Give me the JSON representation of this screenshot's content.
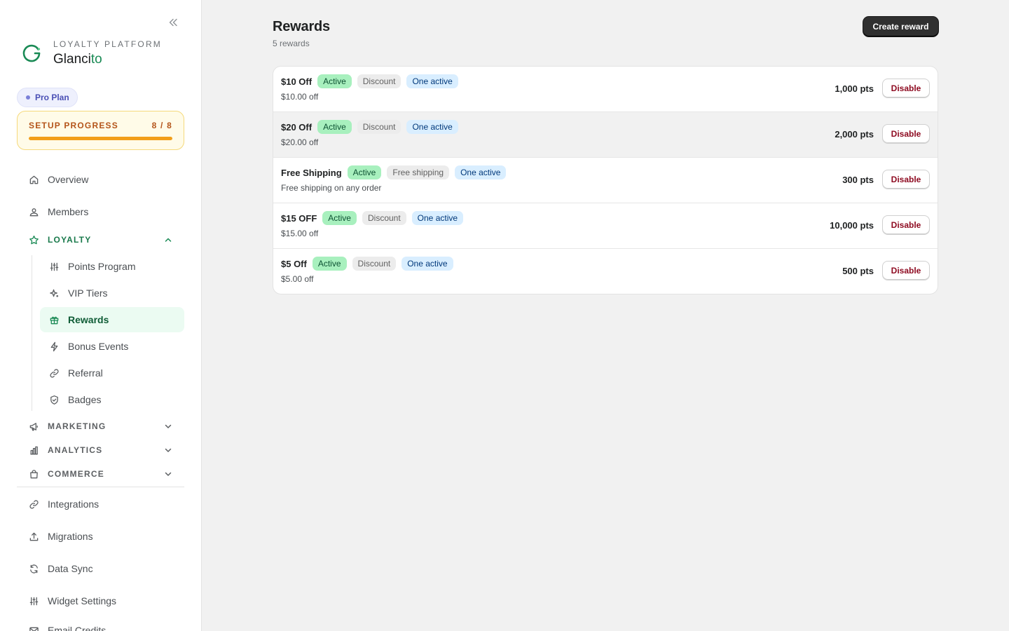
{
  "brand": {
    "eyebrow": "LOYALTY PLATFORM",
    "name_main": "Glanci",
    "name_accent": "to"
  },
  "plan": {
    "label": "Pro Plan"
  },
  "setup": {
    "label": "SETUP PROGRESS",
    "count": "8 / 8",
    "progress": 1.0
  },
  "nav": {
    "overview": "Overview",
    "members": "Members",
    "loyalty": "LOYALTY",
    "loyalty_items": {
      "points": "Points Program",
      "vip": "VIP Tiers",
      "rewards": "Rewards",
      "bonus": "Bonus Events",
      "referral": "Referral",
      "badges": "Badges"
    },
    "marketing": "MARKETING",
    "analytics": "ANALYTICS",
    "commerce": "COMMERCE",
    "integrations": "Integrations",
    "migrations": "Migrations",
    "datasync": "Data Sync",
    "widget": "Widget Settings",
    "email": "Email Credits"
  },
  "page": {
    "title": "Rewards",
    "subtitle": "5 rewards",
    "create_label": "Create reward"
  },
  "rewards": [
    {
      "name": "$10 Off",
      "status": "Active",
      "type": "Discount",
      "limit": "One active",
      "desc": "$10.00 off",
      "points": "1,000 pts",
      "action": "Disable"
    },
    {
      "name": "$20 Off",
      "status": "Active",
      "type": "Discount",
      "limit": "One active",
      "desc": "$20.00 off",
      "points": "2,000 pts",
      "action": "Disable"
    },
    {
      "name": "Free Shipping",
      "status": "Active",
      "type": "Free shipping",
      "limit": "One active",
      "desc": "Free shipping on any order",
      "points": "300 pts",
      "action": "Disable"
    },
    {
      "name": "$15 OFF",
      "status": "Active",
      "type": "Discount",
      "limit": "One active",
      "desc": "$15.00 off",
      "points": "10,000 pts",
      "action": "Disable"
    },
    {
      "name": "$5 Off",
      "status": "Active",
      "type": "Discount",
      "limit": "One active",
      "desc": "$5.00 off",
      "points": "500 pts",
      "action": "Disable"
    }
  ]
}
